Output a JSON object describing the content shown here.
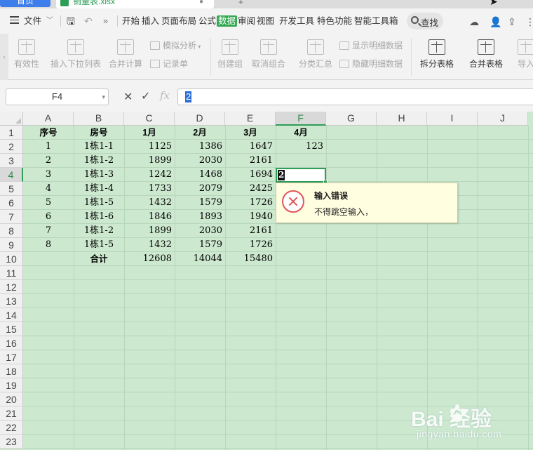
{
  "tabs": {
    "home_label": "首页",
    "file_title": "销量表.xlsx",
    "new_tab": "+"
  },
  "menu": {
    "file_label": "文件",
    "items": [
      "开始",
      "插入",
      "页面布局",
      "公式",
      "数据",
      "审阅",
      "视图",
      "开发工具",
      "特色功能",
      "智能工具箱"
    ],
    "active_item": "数据",
    "search_label": "查找"
  },
  "ribbon": {
    "validity": "有效性",
    "insert_dropdown": "插入下拉列表",
    "consolidate": "合并计算",
    "simulate": "模拟分析",
    "record_form": "记录单",
    "create_group": "创建组",
    "ungroup": "取消组合",
    "subtotal": "分类汇总",
    "show_detail": "显示明细数据",
    "hide_detail": "隐藏明细数据",
    "split_table": "拆分表格",
    "merge_table": "合并表格",
    "import": "导入"
  },
  "formula_bar": {
    "cell_ref": "F4",
    "fx": "fx",
    "value": "2"
  },
  "sheet": {
    "columns": [
      "A",
      "B",
      "C",
      "D",
      "E",
      "F",
      "G",
      "H",
      "I",
      "J"
    ],
    "selected_column": "F",
    "rows": [
      "1",
      "2",
      "3",
      "4",
      "5",
      "6",
      "7",
      "8",
      "9",
      "10",
      "11",
      "12",
      "13",
      "14",
      "15",
      "16",
      "17",
      "18",
      "19",
      "20",
      "21",
      "22",
      "23"
    ],
    "selected_row": "4",
    "headers": [
      "序号",
      "房号",
      "1月",
      "2月",
      "3月",
      "4月"
    ],
    "data": [
      [
        "1",
        "1栋1-1",
        "1125",
        "1386",
        "1647",
        "123"
      ],
      [
        "2",
        "1栋1-2",
        "1899",
        "2030",
        "2161",
        ""
      ],
      [
        "3",
        "1栋1-3",
        "1242",
        "1468",
        "1694",
        ""
      ],
      [
        "4",
        "1栋1-4",
        "1733",
        "2079",
        "2425",
        ""
      ],
      [
        "5",
        "1栋1-5",
        "1432",
        "1579",
        "1726",
        ""
      ],
      [
        "6",
        "1栋1-6",
        "1846",
        "1893",
        "1940",
        ""
      ],
      [
        "7",
        "1栋1-2",
        "1899",
        "2030",
        "2161",
        ""
      ],
      [
        "8",
        "1栋1-5",
        "1432",
        "1579",
        "1726",
        ""
      ]
    ],
    "total": {
      "label": "合计",
      "values": [
        "12608",
        "14044",
        "15480"
      ]
    },
    "active_cell_value": "2"
  },
  "error_tooltip": {
    "title": "输入错误",
    "message": "不得跳空输入，"
  },
  "watermark": {
    "brand": "Bai  经验",
    "url": "jingyan.baidu.com"
  },
  "colors": {
    "sheet_bg": "#cce8cf",
    "accent": "#2e9e57",
    "active_menu": "#34a853",
    "home_tab": "#3d7eea"
  }
}
